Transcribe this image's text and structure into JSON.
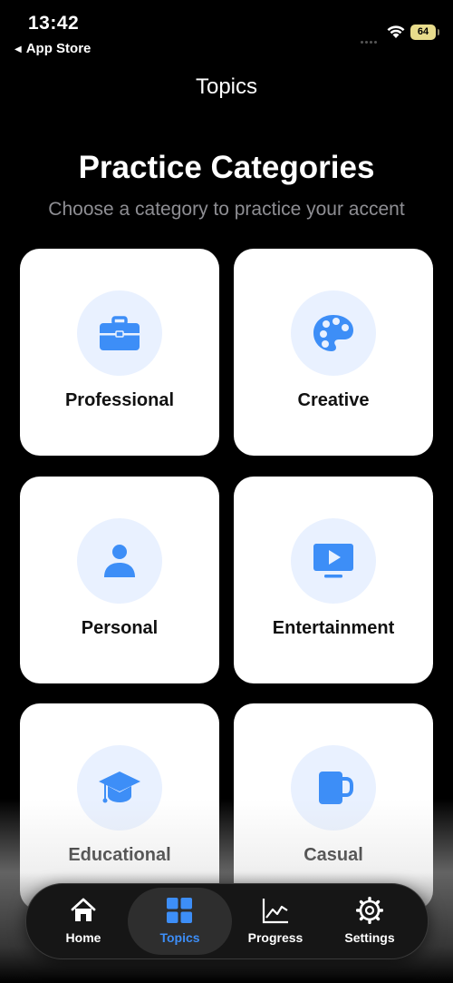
{
  "status_bar": {
    "time": "13:42",
    "back_app": "App Store",
    "battery": "64"
  },
  "nav": {
    "title": "Topics"
  },
  "main": {
    "heading": "Practice Categories",
    "subheading": "Choose a category to practice your accent",
    "accent_color": "#3d8ef7",
    "categories": [
      {
        "label": "Professional",
        "icon": "briefcase-icon"
      },
      {
        "label": "Creative",
        "icon": "palette-icon"
      },
      {
        "label": "Personal",
        "icon": "person-icon"
      },
      {
        "label": "Entertainment",
        "icon": "tv-play-icon"
      },
      {
        "label": "Educational",
        "icon": "graduation-cap-icon"
      },
      {
        "label": "Casual",
        "icon": "mug-icon"
      }
    ]
  },
  "tabbar": {
    "active": "Topics",
    "items": [
      {
        "label": "Home",
        "icon": "house-icon"
      },
      {
        "label": "Topics",
        "icon": "grid-icon"
      },
      {
        "label": "Progress",
        "icon": "chart-icon"
      },
      {
        "label": "Settings",
        "icon": "gear-icon"
      }
    ]
  }
}
